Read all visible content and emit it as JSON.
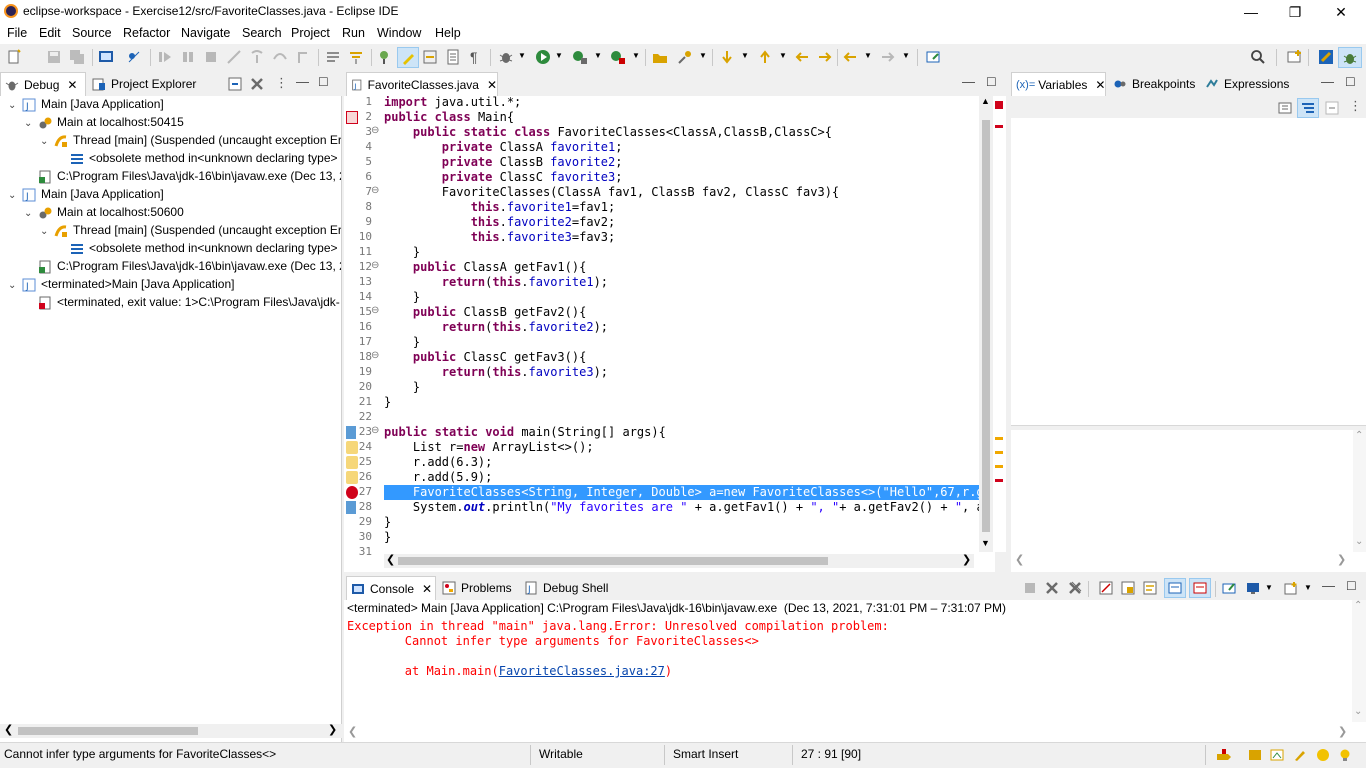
{
  "window": {
    "title": "eclipse-workspace - Exercise12/src/FavoriteClasses.java - Eclipse IDE",
    "minimize": "—",
    "maximize": "❐",
    "close": "✕"
  },
  "menu": [
    "File",
    "Edit",
    "Source",
    "Refactor",
    "Navigate",
    "Search",
    "Project",
    "Run",
    "Window",
    "Help"
  ],
  "left_panel": {
    "tabs": [
      "Debug",
      "Project Explorer"
    ],
    "tree": [
      {
        "level": 0,
        "label": "Main [Java Application]",
        "icon": "java-app-icon"
      },
      {
        "level": 1,
        "label": "Main at localhost:50415",
        "icon": "debug-target-icon"
      },
      {
        "level": 2,
        "label": "Thread [main] (Suspended (uncaught exception Err",
        "icon": "thread-icon"
      },
      {
        "level": 3,
        "label": "<obsolete method in<unknown declaring type>",
        "icon": "stack-frame-icon"
      },
      {
        "level": 1,
        "label": "C:\\Program Files\\Java\\jdk-16\\bin\\javaw.exe (Dec 13, 2",
        "icon": "process-icon"
      },
      {
        "level": 0,
        "label": "Main [Java Application]",
        "icon": "java-app-icon"
      },
      {
        "level": 1,
        "label": "Main at localhost:50600",
        "icon": "debug-target-icon"
      },
      {
        "level": 2,
        "label": "Thread [main] (Suspended (uncaught exception Err",
        "icon": "thread-icon"
      },
      {
        "level": 3,
        "label": "<obsolete method in<unknown declaring type>",
        "icon": "stack-frame-icon"
      },
      {
        "level": 1,
        "label": "C:\\Program Files\\Java\\jdk-16\\bin\\javaw.exe (Dec 13, 2",
        "icon": "process-icon"
      },
      {
        "level": 0,
        "label": "<terminated>Main [Java Application]",
        "icon": "java-app-icon"
      },
      {
        "level": 1,
        "label": "<terminated, exit value: 1>C:\\Program Files\\Java\\jdk-",
        "icon": "terminated-process-icon"
      }
    ]
  },
  "editor": {
    "tab": "FavoriteClasses.java",
    "lines": [
      {
        "n": "1",
        "text": "import java.util.*;"
      },
      {
        "n": "2",
        "text": "public class Main{"
      },
      {
        "n": "3",
        "text": "    public static class FavoriteClasses<ClassA,ClassB,ClassC>{"
      },
      {
        "n": "4",
        "text": "        private ClassA favorite1;"
      },
      {
        "n": "5",
        "text": "        private ClassB favorite2;"
      },
      {
        "n": "6",
        "text": "        private ClassC favorite3;"
      },
      {
        "n": "7",
        "text": "        FavoriteClasses(ClassA fav1, ClassB fav2, ClassC fav3){"
      },
      {
        "n": "8",
        "text": "            this.favorite1=fav1;"
      },
      {
        "n": "9",
        "text": "            this.favorite2=fav2;"
      },
      {
        "n": "10",
        "text": "            this.favorite3=fav3;"
      },
      {
        "n": "11",
        "text": "    }"
      },
      {
        "n": "12",
        "text": "    public ClassA getFav1(){"
      },
      {
        "n": "13",
        "text": "        return(this.favorite1);"
      },
      {
        "n": "14",
        "text": "    }"
      },
      {
        "n": "15",
        "text": "    public ClassB getFav2(){"
      },
      {
        "n": "16",
        "text": "        return(this.favorite2);"
      },
      {
        "n": "17",
        "text": "    }"
      },
      {
        "n": "18",
        "text": "    public ClassC getFav3(){"
      },
      {
        "n": "19",
        "text": "        return(this.favorite3);"
      },
      {
        "n": "20",
        "text": "    }"
      },
      {
        "n": "21",
        "text": "}"
      },
      {
        "n": "22",
        "text": ""
      },
      {
        "n": "23",
        "text": "public static void main(String[] args){"
      },
      {
        "n": "24",
        "text": "    List r=new ArrayList<>();"
      },
      {
        "n": "25",
        "text": "    r.add(6.3);"
      },
      {
        "n": "26",
        "text": "    r.add(5.9);"
      },
      {
        "n": "27",
        "text": "    FavoriteClasses<String, Integer, Double> a=new FavoriteClasses<>(\"Hello\",67,r.get"
      },
      {
        "n": "28",
        "text": "    System.out.println(\"My favorites are \" + a.getFav1() + \", \"+ a.getFav2() + \", and"
      },
      {
        "n": "29",
        "text": "}"
      },
      {
        "n": "30",
        "text": "}"
      },
      {
        "n": "31",
        "text": ""
      }
    ],
    "fold_marker": "⊖"
  },
  "right_panel": {
    "tabs": [
      "Variables",
      "Breakpoints",
      "Expressions"
    ],
    "variables_prefix": "(x)="
  },
  "console": {
    "tabs": [
      "Console",
      "Problems",
      "Debug Shell"
    ],
    "header": "<terminated> Main [Java Application] C:\\Program Files\\Java\\jdk-16\\bin\\javaw.exe  (Dec 13, 2021, 7:31:01 PM – 7:31:07 PM)",
    "line1": "Exception in thread \"main\" java.lang.Error: Unresolved compilation problem: ",
    "line2": "\tCannot infer type arguments for FavoriteClasses<>",
    "line3_prefix": "\tat Main.main(",
    "line3_link": "FavoriteClasses.java:27",
    "line3_suffix": ")",
    "error_color": "#ff0000",
    "link_color": "#0645ad"
  },
  "status": {
    "message": "Cannot infer type arguments for FavoriteClasses<>",
    "mode": "Writable",
    "insert": "Smart Insert",
    "position": "27 : 91 [90]"
  }
}
